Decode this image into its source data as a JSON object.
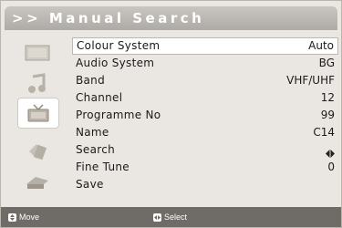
{
  "header": {
    "title": ">> Manual Search"
  },
  "sidebar": {
    "icons": [
      {
        "name": "picture-menu-icon"
      },
      {
        "name": "sound-menu-icon"
      },
      {
        "name": "channel-menu-icon",
        "active": true
      },
      {
        "name": "setup-menu-icon"
      },
      {
        "name": "input-menu-icon"
      }
    ]
  },
  "menu": {
    "items": [
      {
        "label": "Colour System",
        "value": "Auto",
        "selected": true
      },
      {
        "label": "Audio System",
        "value": "BG"
      },
      {
        "label": "Band",
        "value": "VHF/UHF"
      },
      {
        "label": "Channel",
        "value": "12"
      },
      {
        "label": "Programme No",
        "value": "99"
      },
      {
        "label": "Name",
        "value": "C14"
      },
      {
        "label": "Search",
        "value": ""
      },
      {
        "label": "Fine Tune",
        "value": "0"
      },
      {
        "label": "Save",
        "value": ""
      }
    ]
  },
  "footer": {
    "move_label": "Move",
    "select_label": "Select"
  }
}
